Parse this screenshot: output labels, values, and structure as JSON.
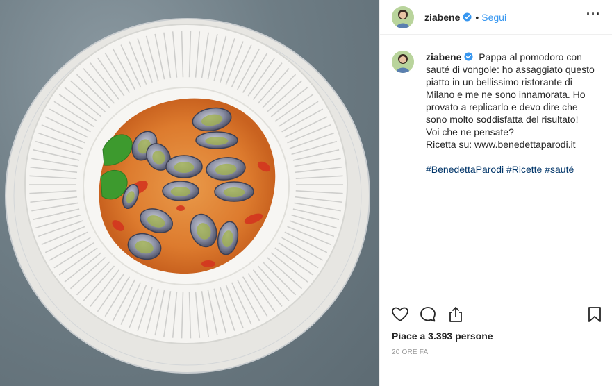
{
  "post": {
    "image_alt": "Pappa al pomodoro con sauté di vongole",
    "author": "ziabene",
    "follow_label": "Segui",
    "separator": "•",
    "more_icon": "more-options-icon"
  },
  "caption": {
    "username": "ziabene",
    "lines": [
      "Pappa al pomodoro con",
      "sauté di vongole: ho assaggiato questo",
      "piatto in un bellissimo ristorante di",
      "Milano e me ne sono innamorata. Ho",
      "provato a replicarlo e devo dire che",
      "sono molto soddisfatta del risultato!",
      "Voi che ne pensate?",
      "Ricetta su: www.benedettaparodi.it"
    ],
    "hashtags": [
      "#BenedettaParodi",
      "#Ricette",
      "#sauté"
    ]
  },
  "actions": {
    "icons": [
      "heart-icon",
      "comment-icon",
      "share-icon",
      "bookmark-icon"
    ]
  },
  "likes": "Piace a 3.393 persone",
  "timestamp": "20 ORE FA",
  "colors": {
    "link": "#3897f0",
    "hashtag": "#003569",
    "verified": "#3897f0",
    "text": "#262626",
    "muted": "#999999"
  }
}
